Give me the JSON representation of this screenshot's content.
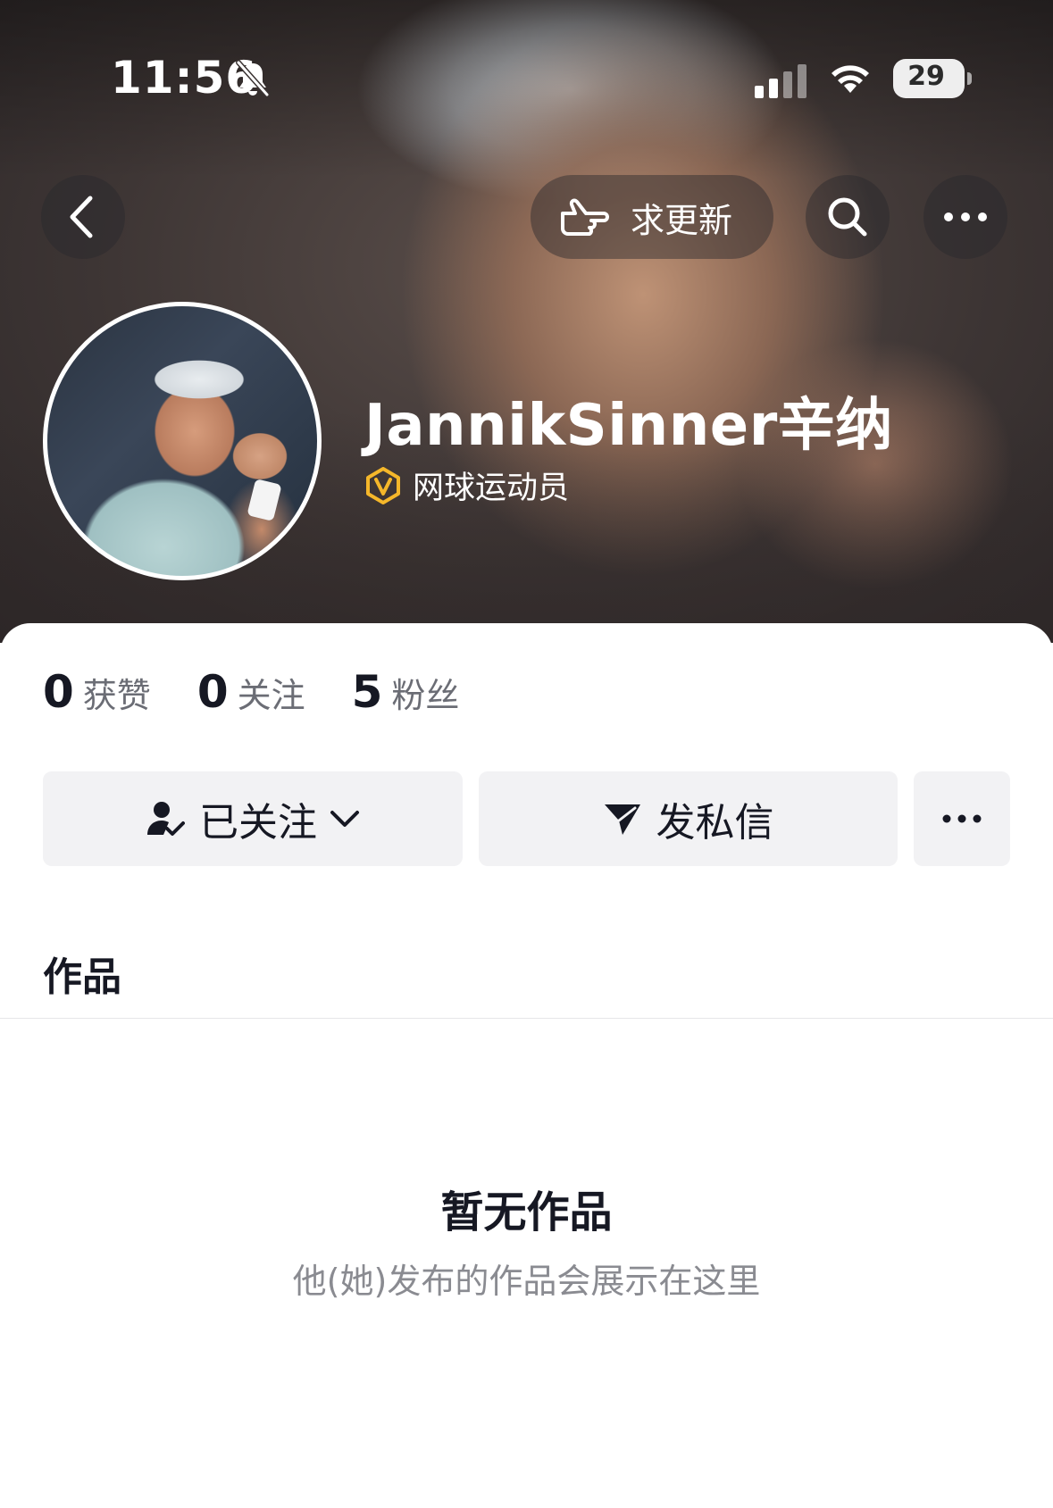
{
  "status_bar": {
    "time": "11:56",
    "battery": "29"
  },
  "nav": {
    "update_label": "求更新"
  },
  "profile": {
    "name": "JannikSinner辛纳",
    "verification": "网球运动员",
    "verify_color": "#f5b72a"
  },
  "stats": [
    {
      "num": "0",
      "label": "获赞"
    },
    {
      "num": "0",
      "label": "关注"
    },
    {
      "num": "5",
      "label": "粉丝"
    }
  ],
  "actions": {
    "follow_label": "已关注",
    "message_label": "发私信"
  },
  "tabs": {
    "works": "作品"
  },
  "empty_state": {
    "title": "暂无作品",
    "subtitle": "他(她)发布的作品会展示在这里"
  }
}
